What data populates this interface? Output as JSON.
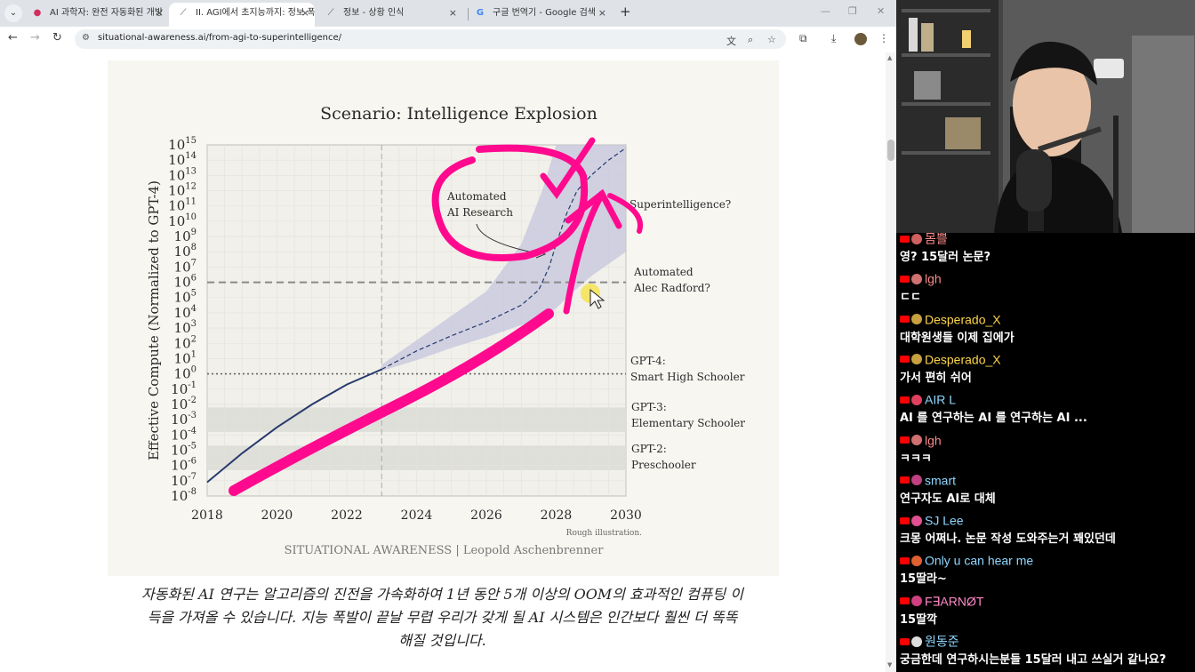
{
  "colors": {
    "accent_pink": "#ff0a8e",
    "chart_navy": "#283a6e",
    "shade": "#c4c6de",
    "highlight": "#f5e23c"
  },
  "browser": {
    "tabs": [
      {
        "label": "AI 과학자: 완전 자동화된 개방",
        "icon": "pin-favicon-icon",
        "active": false
      },
      {
        "label": "II. AGI에서 초지능까지: 정보 폭",
        "icon": "page-favicon-icon",
        "active": true
      },
      {
        "label": "정보 - 상황 인식",
        "icon": "page-favicon-icon",
        "active": false
      },
      {
        "label": "구글 번역기 - Google 검색",
        "icon": "google-favicon-icon",
        "active": false
      }
    ],
    "url": "situational-awareness.ai/from-agi-to-superintelligence/"
  },
  "article": {
    "caption_lines": [
      "자동화된 AI 연구는 알고리즘의 진전을 가속화하여 1년 동안 5개 이상의 OOM의 효과적인 컴퓨팅 이",
      "득을 가져올 수 있습니다. 지능 폭발이 끝날 무렵 우리가 갖게 될 AI 시스템은 인간보다 훨씬 더 똑똑",
      "해질 것입니다."
    ]
  },
  "chart_data": {
    "type": "line",
    "title": "Scenario: Intelligence Explosion",
    "ylabel": "Effective Compute (Normalized to GPT-4)",
    "xlabel": "",
    "xlim": [
      2018,
      2030
    ],
    "x_ticks": [
      "2018",
      "2020",
      "2022",
      "2024",
      "2026",
      "2028",
      "2030"
    ],
    "yscale": "log10",
    "ylim_exponent": [
      -8,
      15
    ],
    "y_tick_exponents": [
      15,
      14,
      13,
      12,
      11,
      10,
      9,
      8,
      7,
      6,
      5,
      4,
      3,
      2,
      1,
      0,
      -1,
      -2,
      -3,
      -4,
      -5,
      -6,
      -7,
      -8
    ],
    "y_tick_base": "10",
    "grid": true,
    "series": [
      {
        "style": "solid",
        "x": [
          2018,
          2019,
          2020,
          2021,
          2022,
          2023
        ],
        "log_y": [
          -7.1,
          -5.2,
          -3.5,
          -2.0,
          -0.7,
          0.3
        ]
      },
      {
        "style": "dashed",
        "x": [
          2023,
          2024,
          2025,
          2026,
          2027,
          2027.5,
          2027.8,
          2028,
          2028.3,
          2028.6,
          2029,
          2029.5,
          2030
        ],
        "log_y": [
          0.3,
          1.5,
          2.5,
          3.4,
          4.5,
          5.5,
          7.0,
          8.5,
          10.5,
          12.0,
          13.0,
          14.0,
          14.8
        ]
      }
    ],
    "uncertainty_band": {
      "x": [
        2023,
        2024,
        2025,
        2026,
        2027,
        2027.6,
        2028,
        2028.5,
        2029,
        2030
      ],
      "log_y_low": [
        0.2,
        0.9,
        1.7,
        2.4,
        3.2,
        3.7,
        4.3,
        5.4,
        6.4,
        8.0
      ],
      "log_y_high": [
        0.6,
        2.2,
        3.8,
        5.4,
        8.5,
        12.0,
        15.0,
        15.0,
        15.0,
        15.0
      ]
    },
    "reference_lines": [
      {
        "log_y": 6,
        "style": "dashed",
        "label_lines": [
          "Automated",
          "Alec Radford?"
        ]
      },
      {
        "log_y": 0,
        "style": "dotted",
        "label_lines": [
          "GPT-4:",
          "Smart High Schooler"
        ]
      }
    ],
    "bands": [
      {
        "log_y": -3,
        "label_lines": [
          "GPT-3:",
          "Elementary Schooler"
        ]
      },
      {
        "log_y": -5.5,
        "label_lines": [
          "GPT-2:",
          "Preschooler"
        ]
      }
    ],
    "vertical_line": {
      "x": 2023,
      "style": "dashed"
    },
    "annotations": [
      {
        "text_lines": [
          "Automated",
          "AI Research"
        ]
      },
      {
        "text": "Superintelligence?"
      }
    ],
    "footnote": "Rough illustration.",
    "credit": "SITUATIONAL AWARENESS | Leopold Aschenbrenner"
  },
  "chat": {
    "messages": [
      {
        "author": "몸쁠",
        "text": "영? 15달러 논문?",
        "author_color": "#ff8a8a",
        "avatar_color": "#d06060"
      },
      {
        "author": "lgh",
        "text": "ㄷㄷ",
        "author_color": "#ff8a8a",
        "avatar_color": "#d07070"
      },
      {
        "author": "Desperado_X",
        "text": "대학원생들 이제 집에가",
        "author_color": "#ffd54a",
        "avatar_color": "#c8a040"
      },
      {
        "author": "Desperado_X",
        "text": "가서 편히 쉬어",
        "author_color": "#ffd54a",
        "avatar_color": "#c8a040"
      },
      {
        "author": "AIR L",
        "text": "AI 를 연구하는 AI 를 연구하는 AI ...",
        "author_color": "#8fd7ff",
        "avatar_color": "#e04060"
      },
      {
        "author": "lgh",
        "text": "ㅋㅋㅋ",
        "author_color": "#ff8a8a",
        "avatar_color": "#d07070"
      },
      {
        "author": "smart",
        "text": "연구자도 AI로 대체",
        "author_color": "#8fd7ff",
        "avatar_color": "#c04080"
      },
      {
        "author": "SJ Lee",
        "text": "크몽 어쩌나. 논문 작성 도와주는거 꽤있던데",
        "author_color": "#8fd7ff",
        "avatar_color": "#e05090"
      },
      {
        "author": "Only u can hear me",
        "text": "15딸라~",
        "author_color": "#8fd7ff",
        "avatar_color": "#e06030"
      },
      {
        "author": "F∃ARNØT",
        "text": "15딸깍",
        "author_color": "#ff8ac8",
        "avatar_color": "#d04080"
      },
      {
        "author": "원동준",
        "text": "궁금한데 연구하시는분들 15달러 내고 쓰실거 같나요?",
        "author_color": "#8fd7ff",
        "avatar_color": "#dddddd"
      }
    ]
  }
}
